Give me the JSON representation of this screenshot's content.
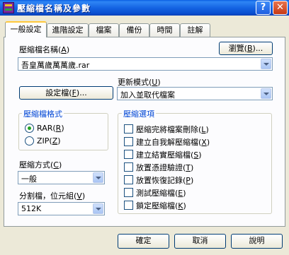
{
  "window": {
    "title": "壓縮檔名稱及參數",
    "help_glyph": "?",
    "close_glyph": "✕"
  },
  "tabs": [
    {
      "label": "一般設定"
    },
    {
      "label": "進階設定"
    },
    {
      "label": "檔案"
    },
    {
      "label": "備份"
    },
    {
      "label": "時間"
    },
    {
      "label": "註解"
    }
  ],
  "archive_name": {
    "label_text": "壓縮檔名稱",
    "label_key": "A",
    "value": "吾皇萬歲萬萬歲.rar",
    "browse_text": "瀏覽",
    "browse_key": "B",
    "browse_suffix": "..."
  },
  "update_mode": {
    "label_text": "更新模式",
    "label_key": "U",
    "value": "加入並取代檔案"
  },
  "profiles": {
    "text": "設定檔",
    "key": "F",
    "suffix": "..."
  },
  "archive_format": {
    "legend": "壓縮檔格式",
    "options": [
      {
        "text": "RAR",
        "key": "R",
        "selected": true
      },
      {
        "text": "ZIP",
        "key": "Z",
        "selected": false
      }
    ]
  },
  "compression_method": {
    "label_text": "壓縮方式",
    "label_key": "C",
    "value": "一般"
  },
  "split_volumes": {
    "label_text": "分割檔，位元組",
    "label_key": "V",
    "value": "512K"
  },
  "archive_options": {
    "legend": "壓縮選項",
    "items": [
      {
        "text": "壓縮完將檔案刪除",
        "key": "L",
        "checked": false
      },
      {
        "text": "建立自我解壓縮檔",
        "key": "X",
        "checked": false
      },
      {
        "text": "建立結實壓縮檔",
        "key": "S",
        "checked": false
      },
      {
        "text": "放置憑證驗證",
        "key": "T",
        "checked": false
      },
      {
        "text": "放置恢復記錄",
        "key": "P",
        "checked": false
      },
      {
        "text": "測試壓縮檔",
        "key": "E",
        "checked": false
      },
      {
        "text": "鎖定壓縮檔",
        "key": "K",
        "checked": false
      }
    ]
  },
  "footer": {
    "ok": "確定",
    "cancel": "取消",
    "help": "說明"
  },
  "colors": {
    "titlebar": "#0a4fd0",
    "dialog_bg": "#ece9d8",
    "group_legend": "#0046d5",
    "radio_dot": "#21a121"
  }
}
